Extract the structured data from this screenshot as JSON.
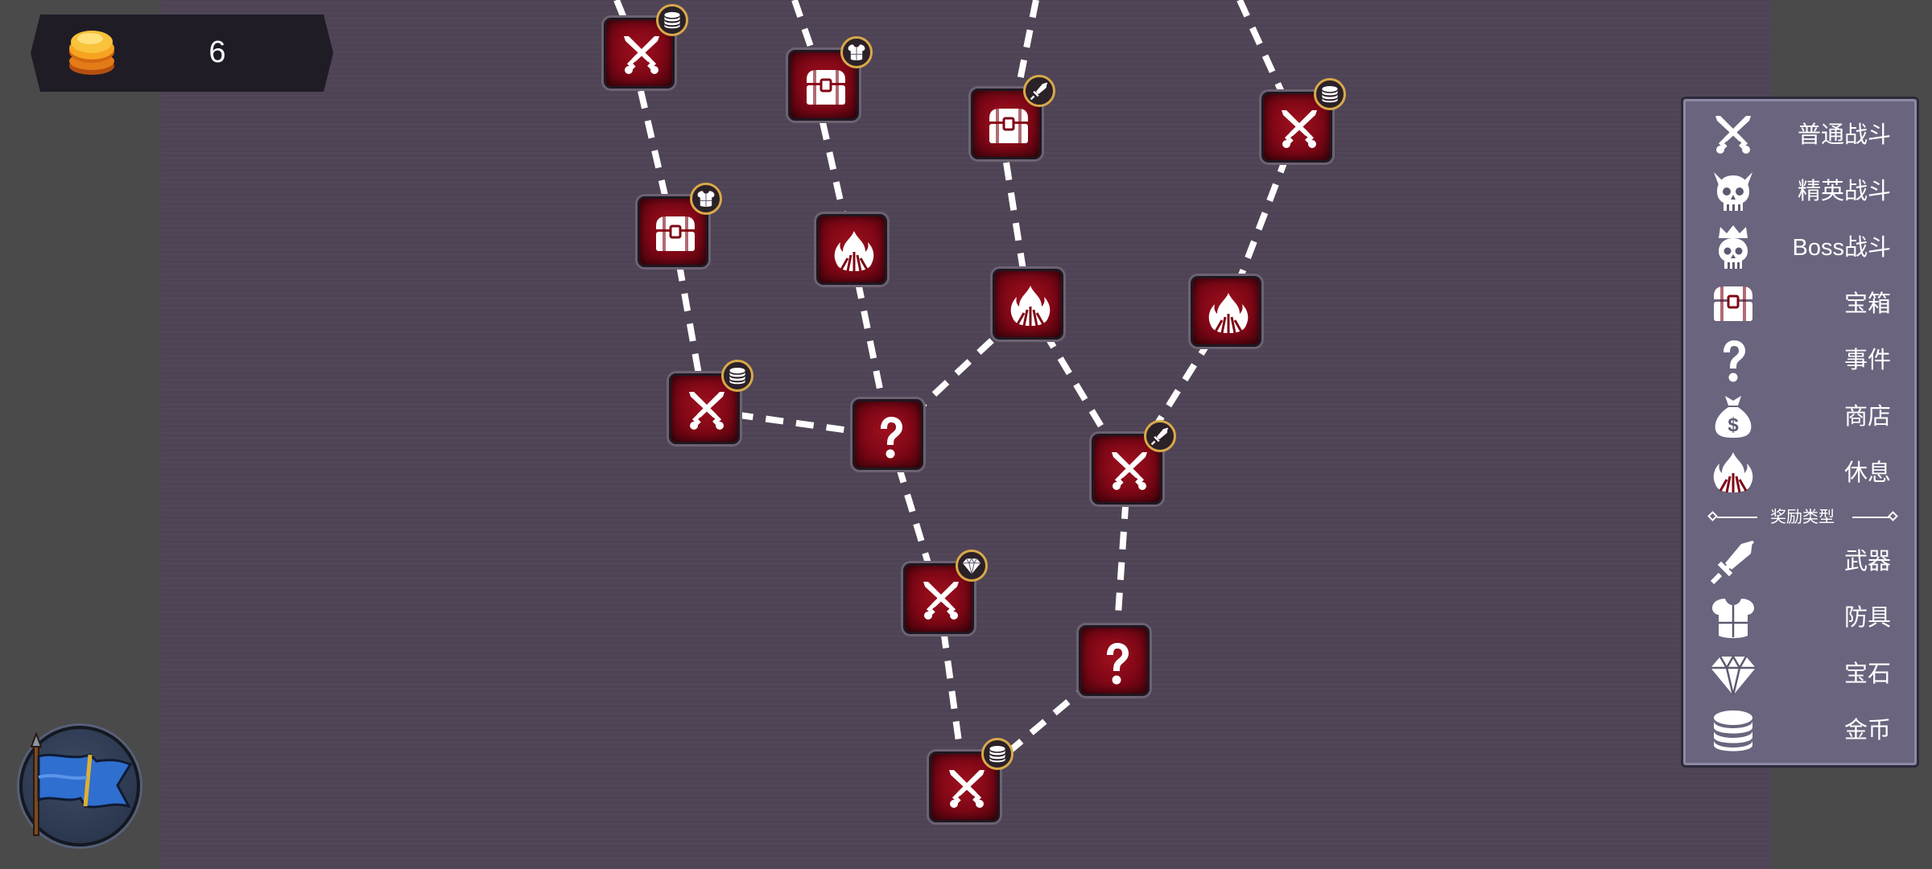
{
  "coins": {
    "count": "6"
  },
  "legend": {
    "node_types": [
      {
        "icon": "crossed-swords-icon",
        "label": "普通战斗"
      },
      {
        "icon": "elite-skull-icon",
        "label": "精英战斗"
      },
      {
        "icon": "boss-crown-skull-icon",
        "label": "Boss战斗"
      },
      {
        "icon": "treasure-chest-icon",
        "label": "宝箱"
      },
      {
        "icon": "question-mark-icon",
        "label": "事件"
      },
      {
        "icon": "money-bag-icon",
        "label": "商店"
      },
      {
        "icon": "campfire-icon",
        "label": "休息"
      }
    ],
    "divider_label": "奖励类型",
    "reward_types": [
      {
        "icon": "sword-icon",
        "label": "武器"
      },
      {
        "icon": "armor-icon",
        "label": "防具"
      },
      {
        "icon": "gem-icon",
        "label": "宝石"
      },
      {
        "icon": "coin-stack-icon",
        "label": "金币"
      }
    ]
  },
  "map_nodes": [
    {
      "type": "battle",
      "reward": "coins"
    },
    {
      "type": "chest",
      "reward": "armor"
    },
    {
      "type": "chest",
      "reward": "weapon"
    },
    {
      "type": "battle",
      "reward": "coins"
    },
    {
      "type": "chest",
      "reward": "armor"
    },
    {
      "type": "rest",
      "reward": ""
    },
    {
      "type": "rest",
      "reward": ""
    },
    {
      "type": "rest",
      "reward": ""
    },
    {
      "type": "battle",
      "reward": "coins"
    },
    {
      "type": "event",
      "reward": ""
    },
    {
      "type": "battle",
      "reward": "weapon"
    },
    {
      "type": "battle",
      "reward": "gem"
    },
    {
      "type": "event",
      "reward": ""
    },
    {
      "type": "battle",
      "reward": "coins"
    }
  ],
  "colors": {
    "node": "#8b0a1a",
    "reward_ring": "#d8a94a",
    "legend_bg": "#6a647e",
    "map_bg": "#4f4455"
  }
}
